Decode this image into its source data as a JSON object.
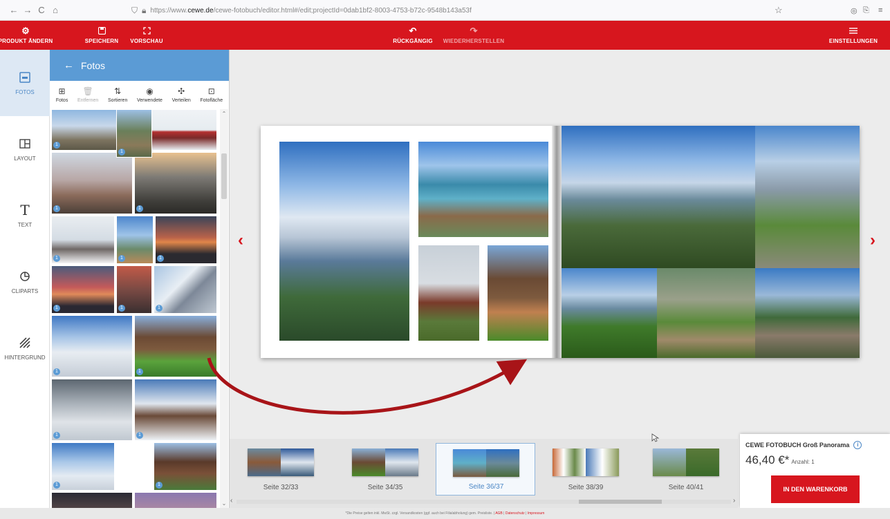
{
  "browser": {
    "url_prefix": "https://www.",
    "url_domain": "cewe.de",
    "url_rest": "/cewe-fotobuch/editor.html#/edit;projectId=0dab1bf2-8003-4753-b72c-9548b143a53f"
  },
  "toolbar": {
    "product_change": "PRODUKT ÄNDERN",
    "save": "SPEICHERN",
    "preview": "VORSCHAU",
    "undo": "RÜCKGÄNGIG",
    "redo": "WIEDERHERSTELLEN",
    "settings": "EINSTELLUNGEN"
  },
  "rail": {
    "photos": "FOTOS",
    "layout": "LAYOUT",
    "text": "TEXT",
    "cliparts": "CLIPARTS",
    "background": "HINTERGRUND"
  },
  "panel": {
    "title": "Fotos",
    "tools": {
      "photos": "Fotos",
      "remove": "Entfernen",
      "sort": "Sortieren",
      "used": "Verwendete",
      "distribute": "Verteilen",
      "photo_area": "Fotofläche"
    },
    "badge": "1"
  },
  "spreads": [
    {
      "label": "Seite 32/33"
    },
    {
      "label": "Seite 34/35"
    },
    {
      "label": "Seite 36/37"
    },
    {
      "label": "Seite 38/39"
    },
    {
      "label": "Seite 40/41"
    }
  ],
  "cart": {
    "product": "CEWE FOTOBUCH Groß Panorama",
    "price": "46,40 €*",
    "qty": "Anzahl: 1",
    "button": "IN DEN WARENKORB"
  },
  "footer": {
    "text": "*Die Preise gelten inkl. MwSt. zzgl. Versandkosten (ggf. auch bei Filialabholung) gem. Preisliste. |",
    "agb": "AGB",
    "sep1": "|",
    "privacy": "Datenschutz",
    "sep2": "|",
    "imprint": "Impressum"
  },
  "colors": {
    "brand_red": "#d7161e",
    "panel_blue": "#5b9bd5"
  }
}
